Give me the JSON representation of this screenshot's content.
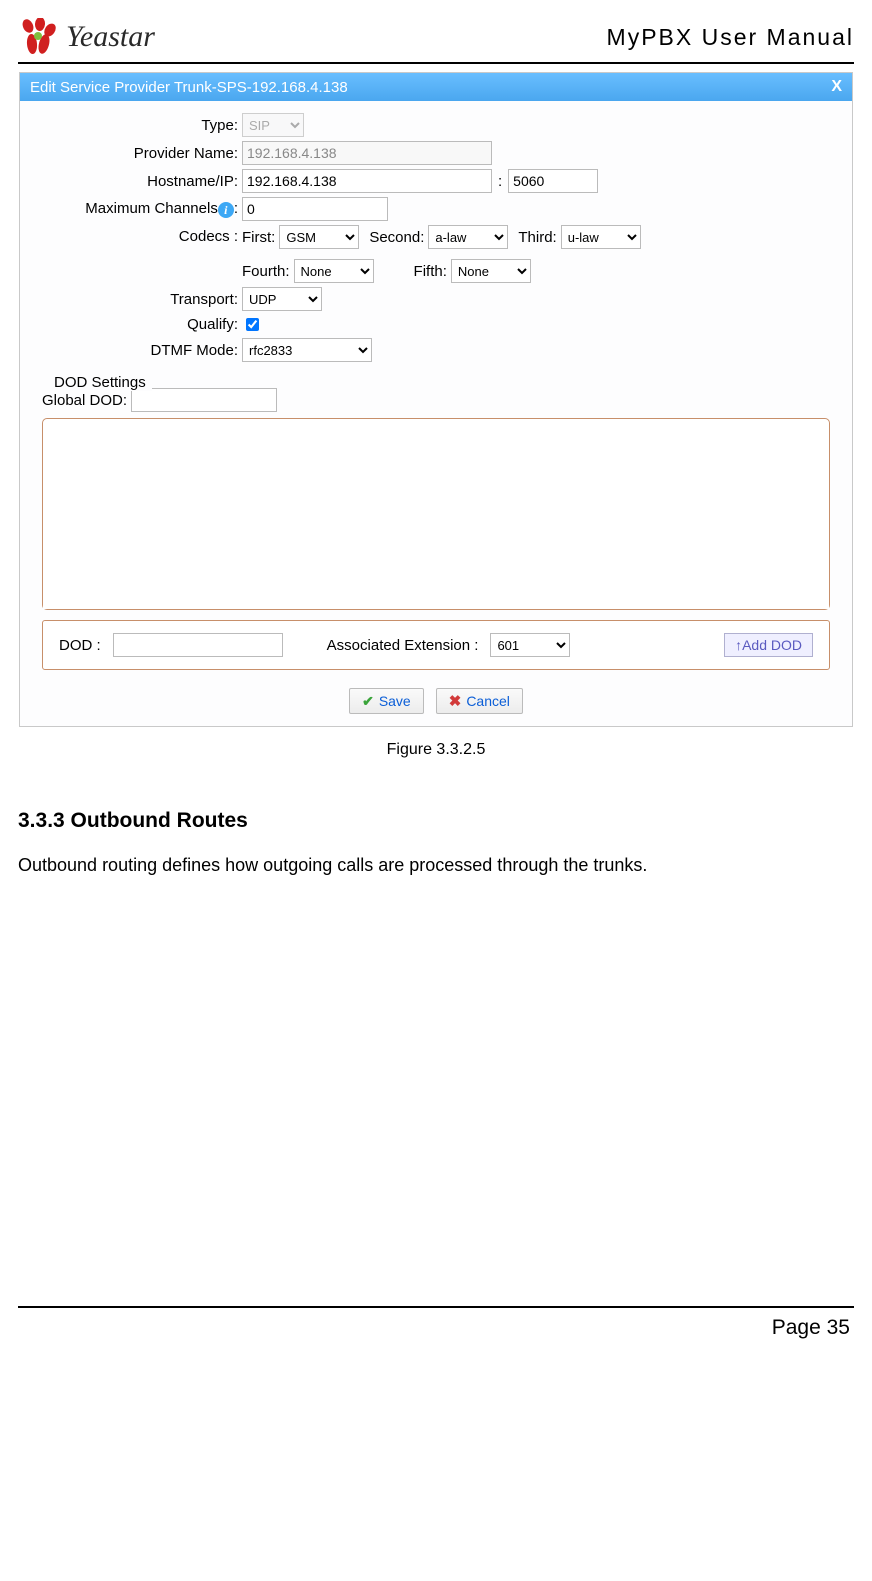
{
  "header": {
    "brand": "Yeastar",
    "manual_title": "MyPBX User Manual"
  },
  "dialog": {
    "title": "Edit Service Provider Trunk-SPS-192.168.4.138",
    "close_label": "X",
    "fields": {
      "type_label": "Type:",
      "type_value": "SIP",
      "provider_name_label": "Provider Name:",
      "provider_name_value": "192.168.4.138",
      "hostname_label": "Hostname/IP:",
      "hostname_value": "192.168.4.138",
      "port_value": "5060",
      "max_channels_label": "Maximum Channels",
      "max_channels_value": "0",
      "codecs_label": "Codecs :",
      "codec_first_label": "First:",
      "codec_first_value": "GSM",
      "codec_second_label": "Second:",
      "codec_second_value": "a-law",
      "codec_third_label": "Third:",
      "codec_third_value": "u-law",
      "codec_fourth_label": "Fourth:",
      "codec_fourth_value": "None",
      "codec_fifth_label": "Fifth:",
      "codec_fifth_value": "None",
      "transport_label": "Transport:",
      "transport_value": "UDP",
      "qualify_label": "Qualify:",
      "qualify_checked": true,
      "dtmf_label": "DTMF Mode:",
      "dtmf_value": "rfc2833"
    },
    "dod": {
      "section_label": "DOD Settings",
      "global_label": "Global DOD:",
      "global_value": "",
      "dod_label": "DOD :",
      "dod_value": "",
      "assoc_ext_label": "Associated Extension :",
      "assoc_ext_value": "601",
      "add_button": "↑Add DOD"
    },
    "buttons": {
      "save": "Save",
      "cancel": "Cancel"
    }
  },
  "figure_caption": "Figure 3.3.2.5",
  "section": {
    "heading": "3.3.3 Outbound Routes",
    "body": "Outbound routing defines how outgoing calls are processed through the trunks."
  },
  "footer": {
    "page_label": "Page 35"
  }
}
